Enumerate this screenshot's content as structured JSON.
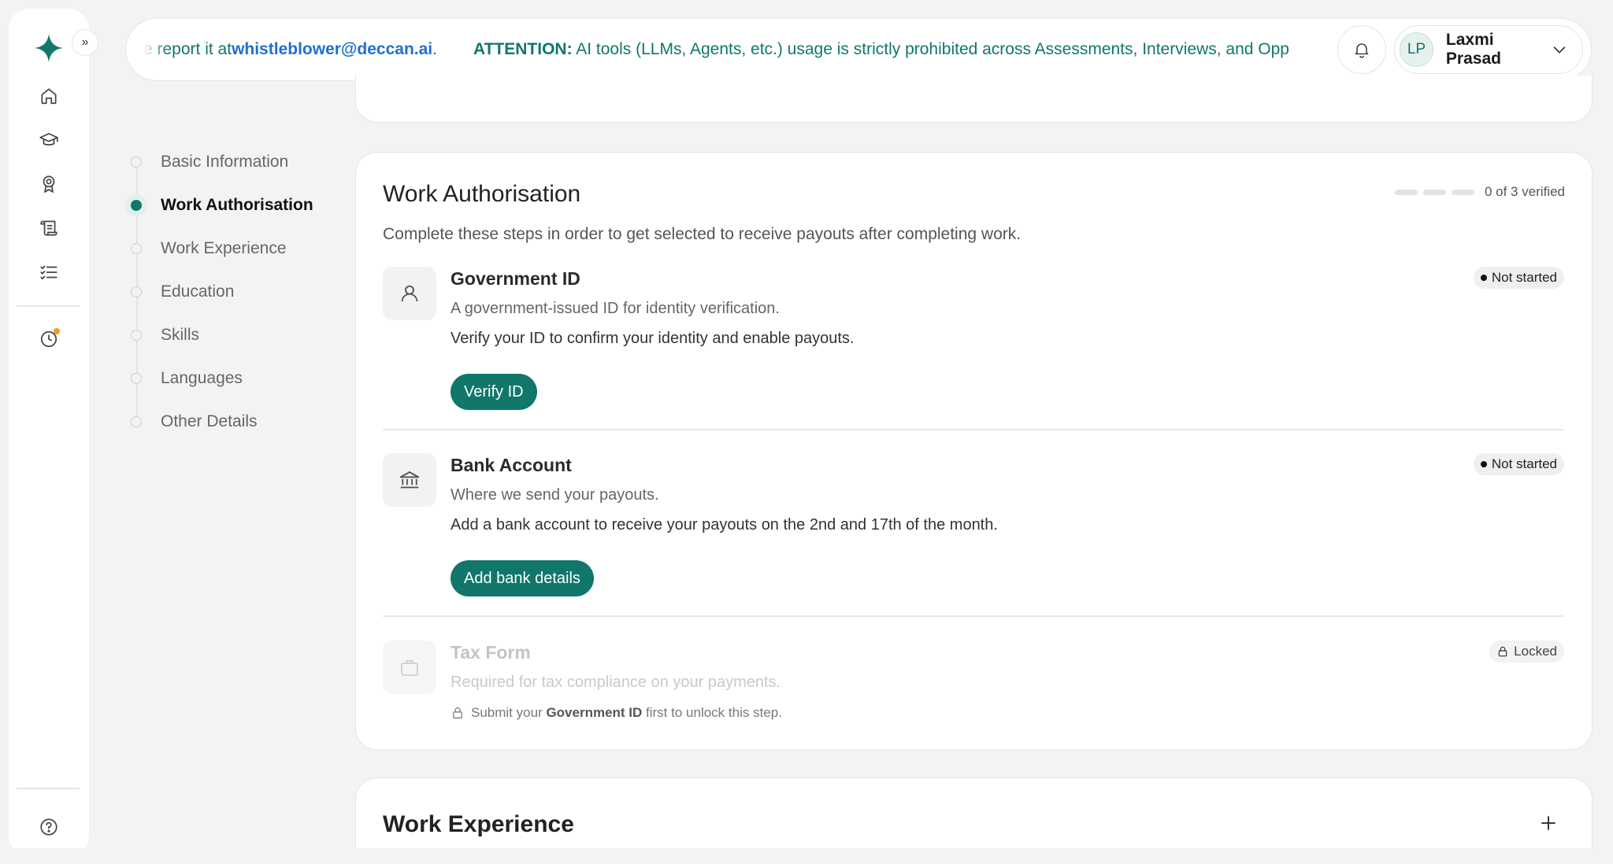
{
  "rail": {
    "icons": [
      "sparkle-logo-icon",
      "home-icon",
      "graduation-cap-icon",
      "award-icon",
      "scroll-icon",
      "checklist-icon",
      "history-icon",
      "help-icon"
    ],
    "expand_glyph": "»",
    "notification_color": "#f29a1f"
  },
  "banner": {
    "prefix": "e report it at ",
    "email": "whistleblower@deccan.ai",
    "suffix": ".",
    "attention_label": "ATTENTION:",
    "attention_text": " AI tools (LLMs, Agents, etc.) usage is strictly prohibited across Assessments, Interviews, and Opp"
  },
  "user": {
    "initials": "LP",
    "name": "Laxmi Prasad"
  },
  "stepper": {
    "steps": [
      {
        "label": "Basic Information",
        "active": false
      },
      {
        "label": "Work Authorisation",
        "active": true
      },
      {
        "label": "Work Experience",
        "active": false
      },
      {
        "label": "Education",
        "active": false
      },
      {
        "label": "Skills",
        "active": false
      },
      {
        "label": "Languages",
        "active": false
      },
      {
        "label": "Other Details",
        "active": false
      }
    ]
  },
  "work_auth": {
    "title": "Work Authorisation",
    "verified_text": "0 of 3 verified",
    "verified_count": 0,
    "verified_total": 3,
    "subtitle": "Complete these steps in order to get selected to receive payouts after completing work.",
    "items": [
      {
        "title": "Government ID",
        "desc": "A government-issued ID for identity verification.",
        "note": "Verify your ID to confirm your identity and enable payouts.",
        "button": "Verify ID",
        "status": "Not started"
      },
      {
        "title": "Bank Account",
        "desc": "Where we send your payouts.",
        "note": "Add a bank account to receive your payouts on the 2nd and 17th of the month.",
        "button": "Add bank details",
        "status": "Not started"
      },
      {
        "title": "Tax Form",
        "desc": "Required for tax compliance on your payments.",
        "lock_pre": "Submit your ",
        "lock_bold": "Government ID",
        "lock_post": " first to unlock this step.",
        "status": "Locked"
      }
    ]
  },
  "work_experience": {
    "title": "Work Experience",
    "add_glyph": "+"
  },
  "colors": {
    "accent": "#10776a",
    "email_link": "#1f6fd1",
    "page_bg": "#f3f3f3"
  }
}
